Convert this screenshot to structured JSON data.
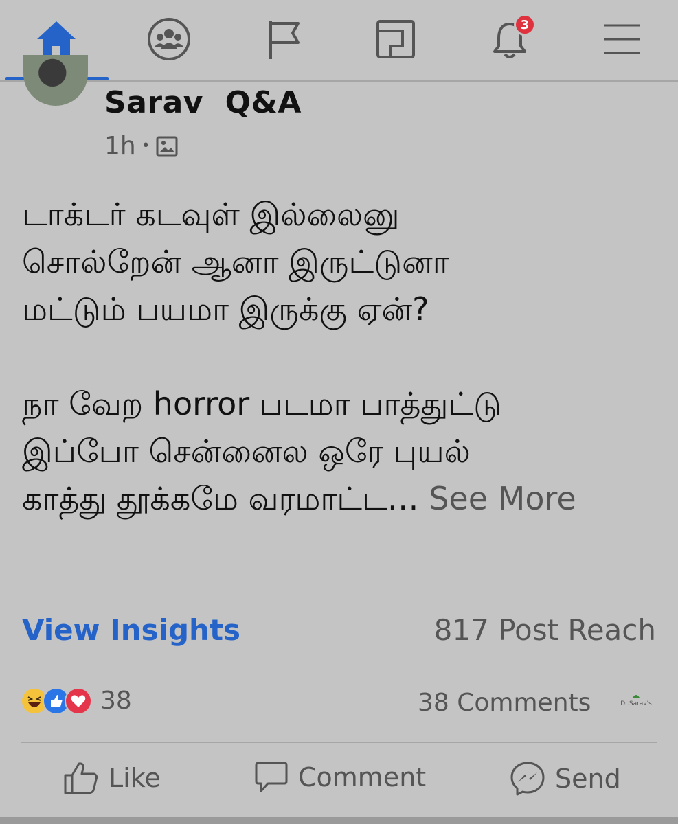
{
  "nav": {
    "items": [
      {
        "name": "home",
        "icon": "home-icon"
      },
      {
        "name": "groups",
        "icon": "groups-icon"
      },
      {
        "name": "pages",
        "icon": "flag-icon"
      },
      {
        "name": "marketplace",
        "icon": "marketplace-icon"
      },
      {
        "name": "notifications",
        "icon": "bell-icon",
        "badge": "3"
      },
      {
        "name": "menu",
        "icon": "menu-icon"
      }
    ],
    "accent_color": "#2563c9",
    "badge_color": "#e0313f"
  },
  "post": {
    "author": "Sarav  Q&A",
    "time": "1h",
    "separator": "•",
    "audience_icon": "photo-icon",
    "lines": [
      "டாக்டர் கடவுள் இல்லைனு",
      "சொல்றேன் ஆனா இருட்டுனா",
      "மட்டும் பயமா இருக்கு ஏன்?",
      "",
      "நா வேற horror படமா பாத்துட்டு",
      "இப்போ சென்னைல ஒரே புயல்",
      "காத்து தூக்கமே வரமாட்ட…"
    ],
    "see_more": "See More"
  },
  "insights": {
    "view_label": "View Insights",
    "reach": "817 Post Reach"
  },
  "engagement": {
    "reaction_icons": [
      "haha-icon",
      "like-icon",
      "love-icon"
    ],
    "reaction_count": "38",
    "comments": "38 Comments",
    "logo_text": "Dr.Sarav's"
  },
  "actions": {
    "like": "Like",
    "comment": "Comment",
    "send": "Send"
  }
}
